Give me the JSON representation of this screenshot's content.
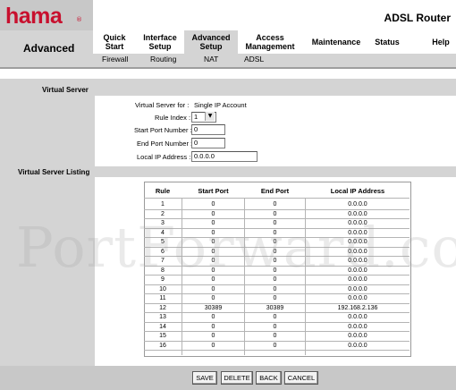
{
  "header": {
    "logo": "hama",
    "logo_mark": "®",
    "product": "ADSL Router"
  },
  "nav": {
    "section": "Advanced",
    "tabs": [
      {
        "label": "Quick\nStart"
      },
      {
        "label": "Interface\nSetup"
      },
      {
        "label": "Advanced\nSetup"
      },
      {
        "label": "Access\nManagement"
      },
      {
        "label": "Maintenance"
      },
      {
        "label": "Status"
      },
      {
        "label": "Help"
      }
    ],
    "subtabs": [
      {
        "label": "Firewall"
      },
      {
        "label": "Routing"
      },
      {
        "label": "NAT"
      },
      {
        "label": "ADSL"
      }
    ]
  },
  "sections": {
    "virtual_server": "Virtual Server",
    "listing": "Virtual Server Listing"
  },
  "form": {
    "for_label": "Virtual Server for :",
    "for_value": "Single IP Account",
    "rule_index_label": "Rule Index :",
    "rule_index_value": "1",
    "start_port_label": "Start Port Number :",
    "start_port_value": "0",
    "end_port_label": "End Port Number :",
    "end_port_value": "0",
    "local_ip_label": "Local IP Address :",
    "local_ip_value": "0.0.0.0"
  },
  "table": {
    "headers": [
      "Rule",
      "Start Port",
      "End Port",
      "Local IP Address"
    ],
    "rows": [
      [
        "1",
        "0",
        "0",
        "0.0.0.0"
      ],
      [
        "2",
        "0",
        "0",
        "0.0.0.0"
      ],
      [
        "3",
        "0",
        "0",
        "0.0.0.0"
      ],
      [
        "4",
        "0",
        "0",
        "0.0.0.0"
      ],
      [
        "5",
        "0",
        "0",
        "0.0.0.0"
      ],
      [
        "6",
        "0",
        "0",
        "0.0.0.0"
      ],
      [
        "7",
        "0",
        "0",
        "0.0.0.0"
      ],
      [
        "8",
        "0",
        "0",
        "0.0.0.0"
      ],
      [
        "9",
        "0",
        "0",
        "0.0.0.0"
      ],
      [
        "10",
        "0",
        "0",
        "0.0.0.0"
      ],
      [
        "11",
        "0",
        "0",
        "0.0.0.0"
      ],
      [
        "12",
        "30389",
        "30389",
        "192.168.2.136"
      ],
      [
        "13",
        "0",
        "0",
        "0.0.0.0"
      ],
      [
        "14",
        "0",
        "0",
        "0.0.0.0"
      ],
      [
        "15",
        "0",
        "0",
        "0.0.0.0"
      ],
      [
        "16",
        "0",
        "0",
        "0.0.0.0"
      ]
    ]
  },
  "buttons": {
    "save": "SAVE",
    "delete": "DELETE",
    "back": "BACK",
    "cancel": "CANCEL"
  },
  "watermark": "PortForward.com",
  "colors": {
    "brand": "#c8102e",
    "panel_gray": "#d4d4d4",
    "footer_gray": "#c8c8c8"
  }
}
